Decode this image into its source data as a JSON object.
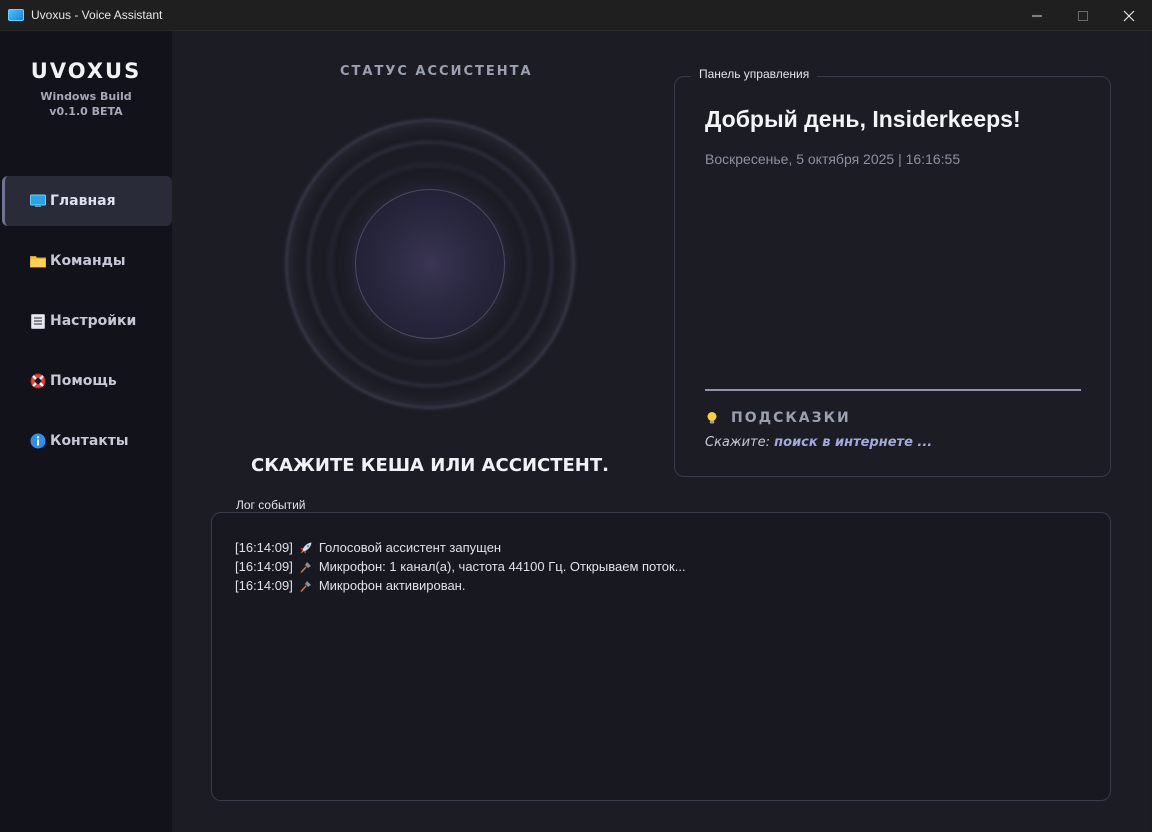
{
  "window": {
    "title": "Uvoxus - Voice Assistant"
  },
  "sidebar": {
    "brand": "UVOXUS",
    "build": "Windows Build",
    "version": "v0.1.0 BETA",
    "items": [
      {
        "label": "Главная",
        "icon": "monitor-icon",
        "active": true
      },
      {
        "label": "Команды",
        "icon": "folder-icon",
        "active": false
      },
      {
        "label": "Настройки",
        "icon": "document-icon",
        "active": false
      },
      {
        "label": "Помощь",
        "icon": "lifebuoy-icon",
        "active": false
      },
      {
        "label": "Контакты",
        "icon": "info-icon",
        "active": false
      }
    ]
  },
  "status": {
    "title": "СТАТУС АССИСТЕНТА",
    "prompt": "СКАЖИТЕ КЕША ИЛИ АССИСТЕНТ."
  },
  "control_panel": {
    "legend": "Панель управления",
    "greeting": "Добрый день, Insiderkeeps!",
    "datetime": "Воскресенье, 5 октября 2025 | 16:16:55",
    "hints_title": "ПОДСКАЗКИ",
    "hint_prefix": "Скажите:",
    "hint_value": "поиск в интернете ..."
  },
  "log": {
    "legend": "Лог событий",
    "entries": [
      {
        "time": "[16:14:09]",
        "icon": "rocket-icon",
        "text": "Голосовой ассистент запущен"
      },
      {
        "time": "[16:14:09]",
        "icon": "microphone-icon",
        "text": "Микрофон: 1 канал(а), частота 44100 Гц. Открываем поток..."
      },
      {
        "time": "[16:14:09]",
        "icon": "microphone-icon",
        "text": "Микрофон активирован."
      }
    ]
  }
}
